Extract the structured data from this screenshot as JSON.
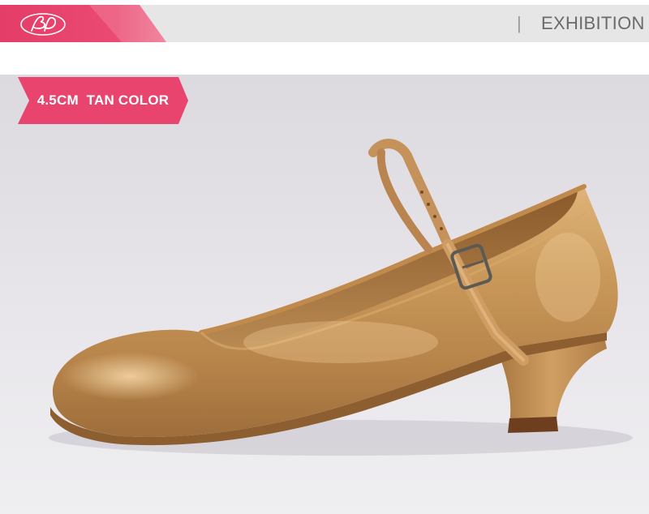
{
  "header": {
    "logo_icon": "bd-logo-icon",
    "separator": "|",
    "title": "EXHIBITION"
  },
  "badge": {
    "label": "4.5CM  TAN COLOR"
  },
  "product": {
    "image_icon": "shoe-photo"
  },
  "colors": {
    "brand_pink": "#e9446e",
    "header_gray": "#e6e6e6",
    "satin_tan": "#c99a5c"
  }
}
